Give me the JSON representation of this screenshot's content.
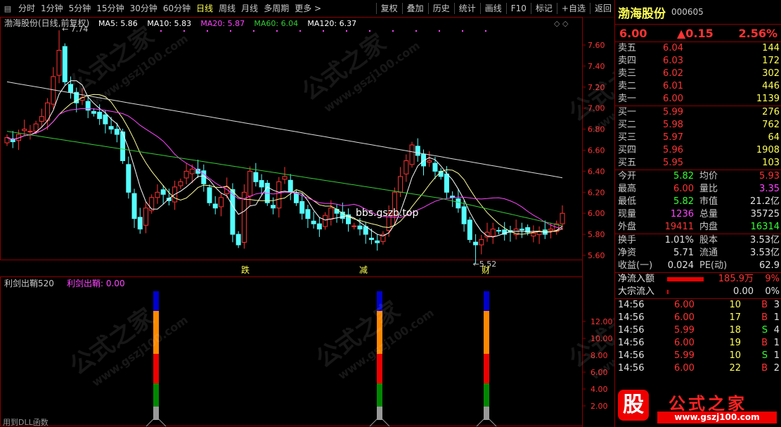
{
  "toolbar": {
    "periods": [
      "分时",
      "1分钟",
      "5分钟",
      "15分钟",
      "30分钟",
      "60分钟",
      "日线",
      "周线",
      "月线",
      "多周期",
      "更多"
    ],
    "active_period": "日线",
    "actions": [
      "复权",
      "叠加",
      "历史",
      "统计",
      "画线",
      "F10",
      "标记",
      "+自选",
      "返回"
    ]
  },
  "main_chart": {
    "title": "渤海股份(日线,前复权)",
    "ma": [
      {
        "label": "MA5: 5.86",
        "color": "#ffffff"
      },
      {
        "label": "MA10: 5.83",
        "color": "#ffffff"
      },
      {
        "label": "MA20: 5.87",
        "color": "#ff44ff"
      },
      {
        "label": "MA60: 6.04",
        "color": "#33cc33"
      },
      {
        "label": "MA120: 6.37",
        "color": "#ffffff"
      }
    ],
    "price_axis": [
      "7.60",
      "7.40",
      "7.20",
      "7.00",
      "6.80",
      "6.60",
      "6.40",
      "6.20",
      "6.00",
      "5.80",
      "5.60"
    ],
    "high_mark": "7.74",
    "low_mark": "5.52",
    "signals": [
      "跌",
      "减",
      "财"
    ],
    "watermark_text": "bbs.gszb.top"
  },
  "indicator": {
    "title": "利剑出鞘520",
    "value_label": "利剑出鞘: 0.00",
    "axis": [
      "12.00",
      "10.00",
      "8.00",
      "6.00",
      "4.00",
      "2.00"
    ],
    "footer": "用到DLL函数",
    "bar_colors": [
      "#0000cc",
      "#ff8800",
      "#ee0000",
      "#008800",
      "#999999"
    ]
  },
  "watermark": {
    "brand": "公式之家",
    "url": "www.gszj100.com",
    "logo_char": "股"
  },
  "panel": {
    "name": "渤海股份",
    "code": "000605",
    "price": "6.00",
    "change": "▲0.15",
    "change_pct": "2.56%",
    "sells": [
      {
        "label": "卖五",
        "price": "6.04",
        "vol": "144"
      },
      {
        "label": "卖四",
        "price": "6.03",
        "vol": "172"
      },
      {
        "label": "卖三",
        "price": "6.02",
        "vol": "302"
      },
      {
        "label": "卖二",
        "price": "6.01",
        "vol": "446"
      },
      {
        "label": "卖一",
        "price": "6.00",
        "vol": "1139"
      }
    ],
    "buys": [
      {
        "label": "买一",
        "price": "5.99",
        "vol": "276"
      },
      {
        "label": "买二",
        "price": "5.98",
        "vol": "762"
      },
      {
        "label": "买三",
        "price": "5.97",
        "vol": "64"
      },
      {
        "label": "买四",
        "price": "5.96",
        "vol": "1908"
      },
      {
        "label": "买五",
        "price": "5.95",
        "vol": "103"
      }
    ],
    "stats": [
      {
        "l1": "今开",
        "v1": "5.82",
        "c1": "green",
        "l2": "均价",
        "v2": "5.93",
        "c2": "red"
      },
      {
        "l1": "最高",
        "v1": "6.00",
        "c1": "red",
        "l2": "量比",
        "v2": "3.35",
        "c2": "mag"
      },
      {
        "l1": "最低",
        "v1": "5.82",
        "c1": "green",
        "l2": "市值",
        "v2": "21.2亿",
        "c2": "wht"
      },
      {
        "l1": "现量",
        "v1": "1236",
        "c1": "mag",
        "l2": "总量",
        "v2": "35725",
        "c2": "wht"
      },
      {
        "l1": "外盘",
        "v1": "19411",
        "c1": "red",
        "l2": "内盘",
        "v2": "16314",
        "c2": "green"
      }
    ],
    "finance": [
      {
        "l1": "换手",
        "v1": "1.01%",
        "l2": "股本",
        "v2": "3.53亿"
      },
      {
        "l1": "净资",
        "v1": "5.71",
        "l2": "流通",
        "v2": "3.53亿"
      },
      {
        "l1": "收益(一)",
        "v1": "0.024",
        "l2": "PE(动)",
        "v2": "62.9"
      }
    ],
    "flow": [
      {
        "label": "净流入额",
        "value": "185.9万",
        "pct": "9%"
      },
      {
        "label": "大宗流入",
        "value": "0.00",
        "pct": "0%"
      }
    ],
    "ticks": [
      {
        "time": "14:56",
        "price": "6.00",
        "vol": "10",
        "bs": "B",
        "n": "3"
      },
      {
        "time": "14:56",
        "price": "6.00",
        "vol": "17",
        "bs": "B",
        "n": "1"
      },
      {
        "time": "14:56",
        "price": "5.99",
        "vol": "18",
        "bs": "S",
        "n": "4"
      },
      {
        "time": "14:56",
        "price": "6.00",
        "vol": "19",
        "bs": "B",
        "n": "1"
      },
      {
        "time": "14:56",
        "price": "5.99",
        "vol": "10",
        "bs": "S",
        "n": "1"
      },
      {
        "time": "14:56",
        "price": "6.00",
        "vol": "22",
        "bs": "B",
        "n": "2"
      }
    ]
  }
}
